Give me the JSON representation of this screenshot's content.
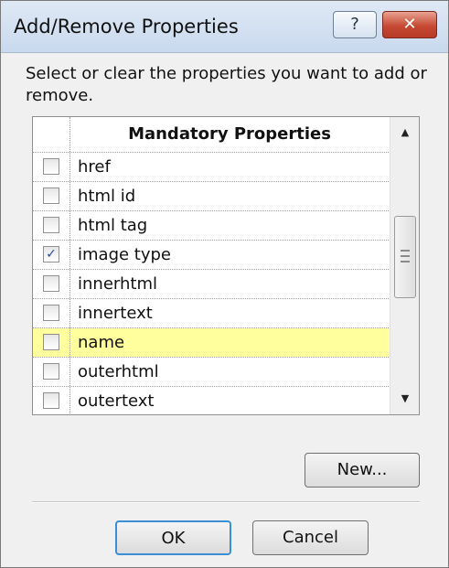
{
  "dialog": {
    "title": "Add/Remove Properties",
    "help_label": "?",
    "close_label": "✕"
  },
  "instructions": "Select or clear the properties you want to add or remove.",
  "grid": {
    "header": "Mandatory Properties",
    "rows": [
      {
        "label": "href",
        "checked": false,
        "highlighted": false,
        "check": ""
      },
      {
        "label": "html id",
        "checked": false,
        "highlighted": false,
        "check": ""
      },
      {
        "label": "html tag",
        "checked": false,
        "highlighted": false,
        "check": ""
      },
      {
        "label": "image type",
        "checked": true,
        "highlighted": false,
        "check": "✓"
      },
      {
        "label": "innerhtml",
        "checked": false,
        "highlighted": false,
        "check": ""
      },
      {
        "label": "innertext",
        "checked": false,
        "highlighted": false,
        "check": ""
      },
      {
        "label": "name",
        "checked": false,
        "highlighted": true,
        "check": ""
      },
      {
        "label": "outerhtml",
        "checked": false,
        "highlighted": false,
        "check": ""
      },
      {
        "label": "outertext",
        "checked": false,
        "highlighted": false,
        "check": ""
      }
    ],
    "scroll_up": "▲",
    "scroll_down": "▼"
  },
  "buttons": {
    "new": "New...",
    "ok": "OK",
    "cancel": "Cancel"
  },
  "colors": {
    "highlight_row": "#ffff9e",
    "ok_focus_border": "#3c8fd6",
    "close_button": "#c64a33"
  }
}
